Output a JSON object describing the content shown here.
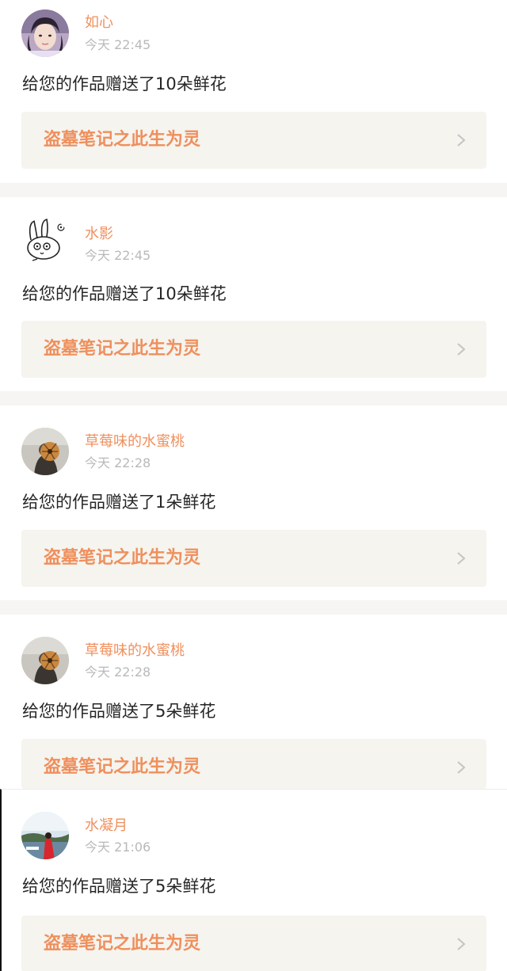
{
  "notifications": [
    {
      "username": "如心",
      "time": "今天 22:45",
      "message": "给您的作品赠送了10朵鲜花",
      "work_title": "盗墓笔记之此生为灵",
      "avatar": "woman-portrait-avatar"
    },
    {
      "username": "水影",
      "time": "今天 22:45",
      "message": "给您的作品赠送了10朵鲜花",
      "work_title": "盗墓笔记之此生为灵",
      "avatar": "cartoon-rabbit-avatar"
    },
    {
      "username": "草莓味的水蜜桃",
      "time": "今天 22:28",
      "message": "给您的作品赠送了1朵鲜花",
      "work_title": "盗墓笔记之此生为灵",
      "avatar": "person-with-fan-avatar"
    },
    {
      "username": "草莓味的水蜜桃",
      "time": "今天 22:28",
      "message": "给您的作品赠送了5朵鲜花",
      "work_title": "盗墓笔记之此生为灵",
      "avatar": "person-with-fan-avatar"
    },
    {
      "username": "水凝月",
      "time": "今天 21:06",
      "message": "给您的作品赠送了5朵鲜花",
      "work_title": "盗墓笔记之此生为灵",
      "avatar": "landscape-photo-avatar"
    }
  ],
  "colors": {
    "username": "#f0905e",
    "work_title": "#ef8f5c",
    "card_bg": "#f5f4ef",
    "time": "#b9b9b9",
    "message": "#262626",
    "separator": "#f6f5f3"
  }
}
